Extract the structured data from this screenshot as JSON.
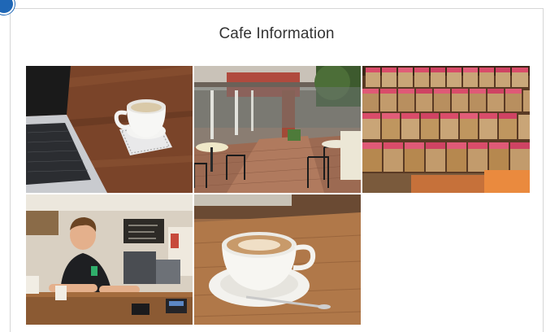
{
  "page": {
    "title": "Cafe Information",
    "accent": "#1f67b6"
  },
  "gallery": {
    "photos": [
      {
        "id": "laptop-coffee"
      },
      {
        "id": "courtyard-patio"
      },
      {
        "id": "coffee-bags"
      },
      {
        "id": "barista-counter"
      },
      {
        "id": "latte-cup"
      }
    ]
  }
}
